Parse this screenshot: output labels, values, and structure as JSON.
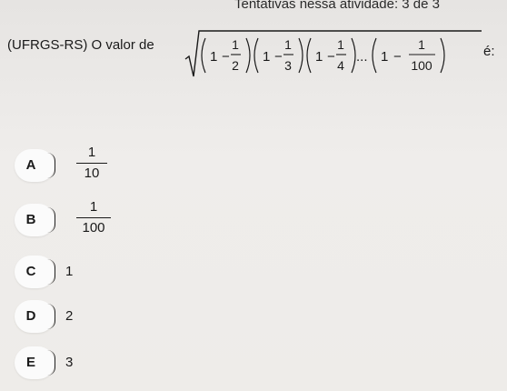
{
  "header": {
    "attempts_text": "Tentativas nessa atividade: 3 de 3"
  },
  "question": {
    "prefix": "(UFRGS-RS) O valor de",
    "suffix": "é:",
    "formula_parts": {
      "one": "1",
      "minus": "−",
      "ellipsis": "...",
      "denominators": [
        "2",
        "3",
        "4",
        "100"
      ]
    }
  },
  "options": [
    {
      "letter": "A",
      "numerator": "1",
      "denominator": "10"
    },
    {
      "letter": "B",
      "numerator": "1",
      "denominator": "100"
    },
    {
      "letter": "C",
      "value": "1"
    },
    {
      "letter": "D",
      "value": "2"
    },
    {
      "letter": "E",
      "value": "3"
    }
  ]
}
